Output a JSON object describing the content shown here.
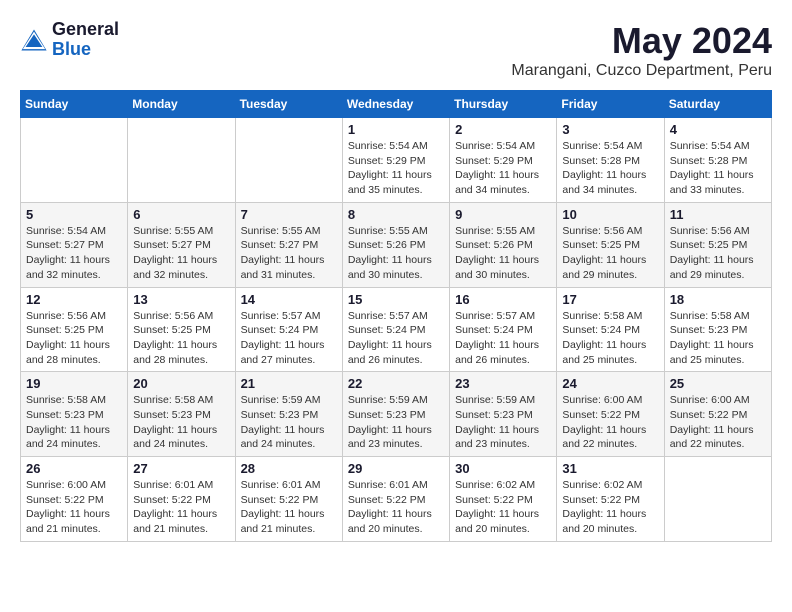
{
  "header": {
    "logo_general": "General",
    "logo_blue": "Blue",
    "month_title": "May 2024",
    "location": "Marangani, Cuzco Department, Peru"
  },
  "calendar": {
    "days_of_week": [
      "Sunday",
      "Monday",
      "Tuesday",
      "Wednesday",
      "Thursday",
      "Friday",
      "Saturday"
    ],
    "weeks": [
      [
        {
          "day": "",
          "info": ""
        },
        {
          "day": "",
          "info": ""
        },
        {
          "day": "",
          "info": ""
        },
        {
          "day": "1",
          "info": "Sunrise: 5:54 AM\nSunset: 5:29 PM\nDaylight: 11 hours\nand 35 minutes."
        },
        {
          "day": "2",
          "info": "Sunrise: 5:54 AM\nSunset: 5:29 PM\nDaylight: 11 hours\nand 34 minutes."
        },
        {
          "day": "3",
          "info": "Sunrise: 5:54 AM\nSunset: 5:28 PM\nDaylight: 11 hours\nand 34 minutes."
        },
        {
          "day": "4",
          "info": "Sunrise: 5:54 AM\nSunset: 5:28 PM\nDaylight: 11 hours\nand 33 minutes."
        }
      ],
      [
        {
          "day": "5",
          "info": "Sunrise: 5:54 AM\nSunset: 5:27 PM\nDaylight: 11 hours\nand 32 minutes."
        },
        {
          "day": "6",
          "info": "Sunrise: 5:55 AM\nSunset: 5:27 PM\nDaylight: 11 hours\nand 32 minutes."
        },
        {
          "day": "7",
          "info": "Sunrise: 5:55 AM\nSunset: 5:27 PM\nDaylight: 11 hours\nand 31 minutes."
        },
        {
          "day": "8",
          "info": "Sunrise: 5:55 AM\nSunset: 5:26 PM\nDaylight: 11 hours\nand 30 minutes."
        },
        {
          "day": "9",
          "info": "Sunrise: 5:55 AM\nSunset: 5:26 PM\nDaylight: 11 hours\nand 30 minutes."
        },
        {
          "day": "10",
          "info": "Sunrise: 5:56 AM\nSunset: 5:25 PM\nDaylight: 11 hours\nand 29 minutes."
        },
        {
          "day": "11",
          "info": "Sunrise: 5:56 AM\nSunset: 5:25 PM\nDaylight: 11 hours\nand 29 minutes."
        }
      ],
      [
        {
          "day": "12",
          "info": "Sunrise: 5:56 AM\nSunset: 5:25 PM\nDaylight: 11 hours\nand 28 minutes."
        },
        {
          "day": "13",
          "info": "Sunrise: 5:56 AM\nSunset: 5:25 PM\nDaylight: 11 hours\nand 28 minutes."
        },
        {
          "day": "14",
          "info": "Sunrise: 5:57 AM\nSunset: 5:24 PM\nDaylight: 11 hours\nand 27 minutes."
        },
        {
          "day": "15",
          "info": "Sunrise: 5:57 AM\nSunset: 5:24 PM\nDaylight: 11 hours\nand 26 minutes."
        },
        {
          "day": "16",
          "info": "Sunrise: 5:57 AM\nSunset: 5:24 PM\nDaylight: 11 hours\nand 26 minutes."
        },
        {
          "day": "17",
          "info": "Sunrise: 5:58 AM\nSunset: 5:24 PM\nDaylight: 11 hours\nand 25 minutes."
        },
        {
          "day": "18",
          "info": "Sunrise: 5:58 AM\nSunset: 5:23 PM\nDaylight: 11 hours\nand 25 minutes."
        }
      ],
      [
        {
          "day": "19",
          "info": "Sunrise: 5:58 AM\nSunset: 5:23 PM\nDaylight: 11 hours\nand 24 minutes."
        },
        {
          "day": "20",
          "info": "Sunrise: 5:58 AM\nSunset: 5:23 PM\nDaylight: 11 hours\nand 24 minutes."
        },
        {
          "day": "21",
          "info": "Sunrise: 5:59 AM\nSunset: 5:23 PM\nDaylight: 11 hours\nand 24 minutes."
        },
        {
          "day": "22",
          "info": "Sunrise: 5:59 AM\nSunset: 5:23 PM\nDaylight: 11 hours\nand 23 minutes."
        },
        {
          "day": "23",
          "info": "Sunrise: 5:59 AM\nSunset: 5:23 PM\nDaylight: 11 hours\nand 23 minutes."
        },
        {
          "day": "24",
          "info": "Sunrise: 6:00 AM\nSunset: 5:22 PM\nDaylight: 11 hours\nand 22 minutes."
        },
        {
          "day": "25",
          "info": "Sunrise: 6:00 AM\nSunset: 5:22 PM\nDaylight: 11 hours\nand 22 minutes."
        }
      ],
      [
        {
          "day": "26",
          "info": "Sunrise: 6:00 AM\nSunset: 5:22 PM\nDaylight: 11 hours\nand 21 minutes."
        },
        {
          "day": "27",
          "info": "Sunrise: 6:01 AM\nSunset: 5:22 PM\nDaylight: 11 hours\nand 21 minutes."
        },
        {
          "day": "28",
          "info": "Sunrise: 6:01 AM\nSunset: 5:22 PM\nDaylight: 11 hours\nand 21 minutes."
        },
        {
          "day": "29",
          "info": "Sunrise: 6:01 AM\nSunset: 5:22 PM\nDaylight: 11 hours\nand 20 minutes."
        },
        {
          "day": "30",
          "info": "Sunrise: 6:02 AM\nSunset: 5:22 PM\nDaylight: 11 hours\nand 20 minutes."
        },
        {
          "day": "31",
          "info": "Sunrise: 6:02 AM\nSunset: 5:22 PM\nDaylight: 11 hours\nand 20 minutes."
        },
        {
          "day": "",
          "info": ""
        }
      ]
    ]
  }
}
